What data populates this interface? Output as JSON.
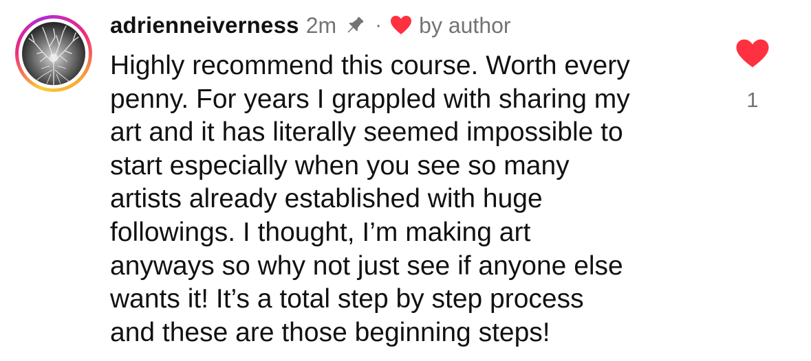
{
  "comment": {
    "username": "adrienneiverness",
    "timestamp": "2m",
    "separator": "·",
    "liked_by_label": "by author",
    "text": "Highly recommend this course. Worth every\npenny. For years I grappled with sharing my\nart and it has literally seemed impossible to\nstart especially when you see so many\nartists already established with huge\nfollowings. I thought, I’m making art\nanyways so why not just see if anyone else\nwants it! It’s a total step by step process\nand these are those beginning steps!",
    "like_count": "1",
    "icons": {
      "pin": "pin-icon",
      "author_like": "heart-icon",
      "like": "heart-icon"
    },
    "colors": {
      "heart": "#ff3040",
      "secondary_text": "#737373",
      "primary_text": "#111111",
      "story_ring": [
        "#f9ce34",
        "#ee2a7b",
        "#b02bd6"
      ]
    }
  }
}
